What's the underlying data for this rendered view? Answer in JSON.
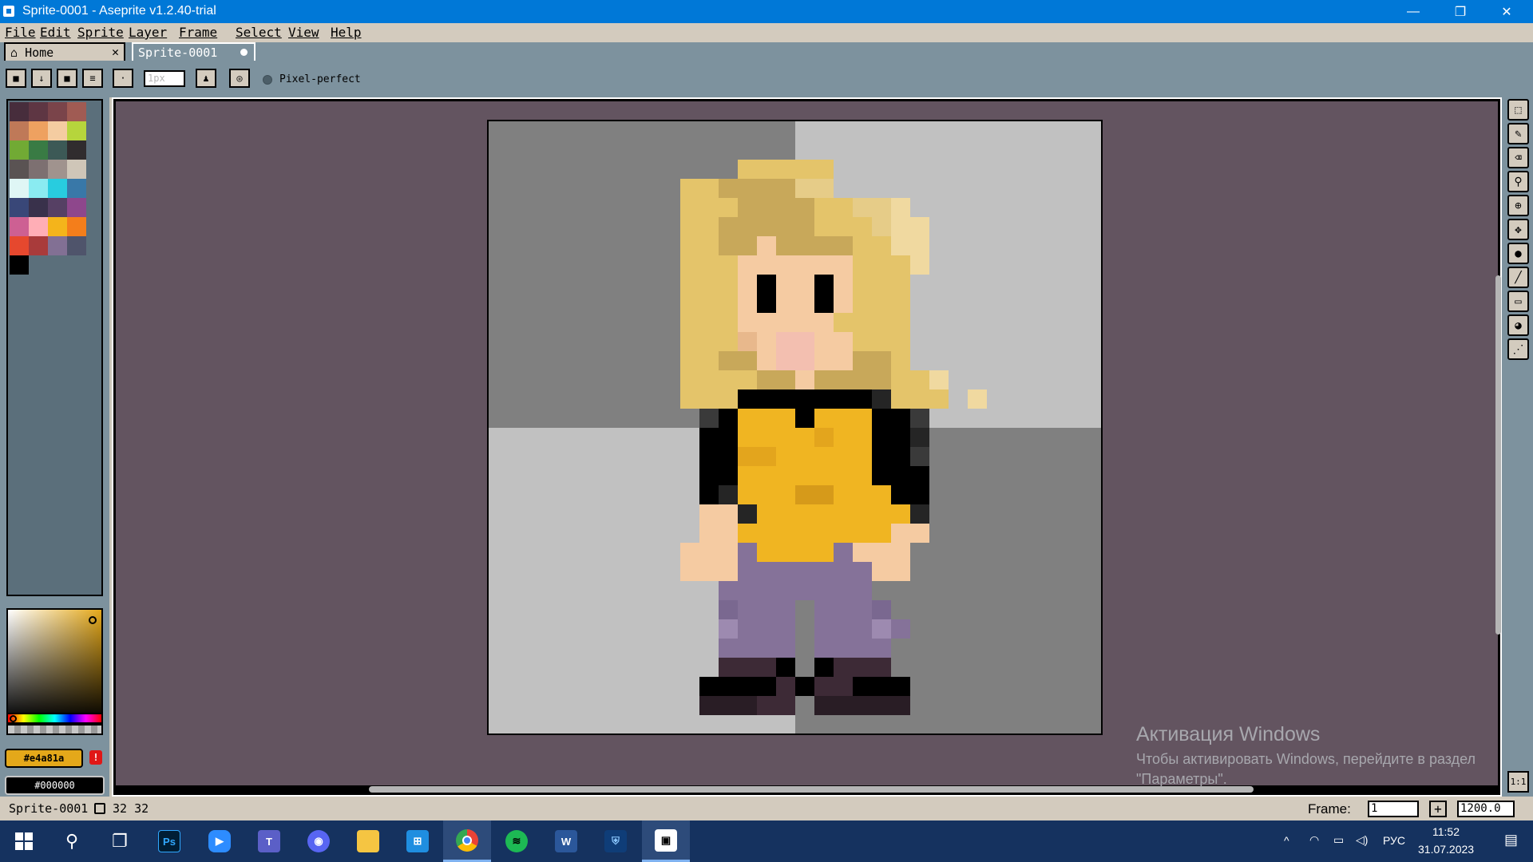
{
  "window": {
    "title": "Sprite-0001 - Aseprite v1.2.40-trial",
    "controls": {
      "minimize": "—",
      "restore": "❐",
      "close": "✕"
    }
  },
  "menu": [
    "File",
    "Edit",
    "Sprite",
    "Layer",
    "Frame",
    "Select",
    "View",
    "Help"
  ],
  "tabs": [
    {
      "label": "Home",
      "icon": "home-icon",
      "close": "✕"
    },
    {
      "label": "Sprite-0001",
      "active": true
    }
  ],
  "toolbar": {
    "brush_size": "1px",
    "pixel_perfect": "Pixel-perfect"
  },
  "palette": {
    "colors": [
      "#472d3c",
      "#5e3643",
      "#7a444a",
      "#a05b53",
      "#bf7958",
      "#eea160",
      "#f4cca1",
      "#b6d53c",
      "#71aa34",
      "#397b44",
      "#3c5956",
      "#302c2e",
      "#5a5353",
      "#7d7071",
      "#a0938e",
      "#cfc6b8",
      "#dff6f5",
      "#8aebf1",
      "#28ccdf",
      "#3978a8",
      "#394778",
      "#39314b",
      "#564064",
      "#8e478c",
      "#cd6093",
      "#ffaeb6",
      "#f4b41b",
      "#f47e1b",
      "#e6482e",
      "#a93b3b",
      "#827094",
      "#4f546b",
      "#000000"
    ]
  },
  "colors": {
    "foreground": "#e4a81a",
    "background": "#000000",
    "warning_icon": "!"
  },
  "sprite": {
    "palette": {
      "a": "#e4c46a",
      "b": "#c8a85a",
      "c": "#e6cc88",
      "d": "#f0d9a0",
      "s": "#f5cba2",
      "t": "#e8b88c",
      "k": "#000000",
      "m": "#f3bfb0",
      "n": "#d6a27a",
      "g": "#252525",
      "h": "#3a3a3a",
      "y": "#f0b522",
      "u": "#e3a51d",
      "w": "#d69a1a",
      "p": "#857299",
      "q": "#7a6890",
      "r": "#9d8ab0",
      "x": "#3d2a36",
      "z": "#291d25"
    },
    "rows": [
      "................................",
      "................................",
      ".............aaaaa..............",
      "..........aabbbbcc..............",
      "..........aaabbbbaaccd..........",
      "..........aabbbbbaaacdd.........",
      "..........aabbsbbbbaadd.........",
      "..........aaassssssaaad.........",
      "..........aaaskssksaaa..........",
      "..........aaaskssksaaa..........",
      "..........aaasssssaaaa..........",
      "..........aaatsmmssaaa..........",
      "..........aabbsmmssbba..........",
      "..........aaaabbsbbbbaad........",
      "..........aaakkkkkkkgaaa.d......",
      "...........hkyyykyyykkh.........",
      "...........kkyyyyuyykkg.........",
      "...........kkuuyyyyykkh.........",
      "...........kkyyyyyyykkk.........",
      "...........kgyyywwyyykk.........",
      "...........ssgyyyyyyyyg.........",
      "...........ssyyyyyyyyss.........",
      "..........ssspyyyypsss..........",
      "..........ssspppppppss..........",
      "............pppppppp............",
      "............qppp.pppq...........",
      "............rppp.ppprp..........",
      "............pppp.pppp...........",
      "............xxxk.kxxx...........",
      "...........kkkkxkxxkkk..........",
      "...........zzzxx.zzzzz..........",
      "................................"
    ]
  },
  "watermark": {
    "title": "Активация Windows",
    "line1": "Чтобы активировать Windows, перейдите в раздел",
    "line2": "\"Параметры\"."
  },
  "tools": [
    "rectangular-marquee-icon",
    "pencil-icon",
    "eraser-icon",
    "eyedropper-icon",
    "zoom-icon",
    "move-icon",
    "paint-bucket-icon",
    "line-icon",
    "rectangle-icon",
    "contour-icon",
    "blur-icon"
  ],
  "zoom_reset": "1:1",
  "status": {
    "sprite_name": "Sprite-0001",
    "size": "32 32",
    "frame_label": "Frame:",
    "frame_value": "1",
    "zoom": "1200.0"
  },
  "taskbar": {
    "apps": [
      "start-icon",
      "search-icon",
      "task-view-icon",
      "photoshop-icon",
      "zoom-icon",
      "teams-icon",
      "discord-icon",
      "file-explorer-icon",
      "store-icon",
      "chrome-icon",
      "spotify-icon",
      "word-icon",
      "defender-icon",
      "aseprite-icon"
    ],
    "photoshop": "Ps",
    "word": "W",
    "language": "РУС",
    "time": "11:52",
    "date": "31.07.2023"
  }
}
